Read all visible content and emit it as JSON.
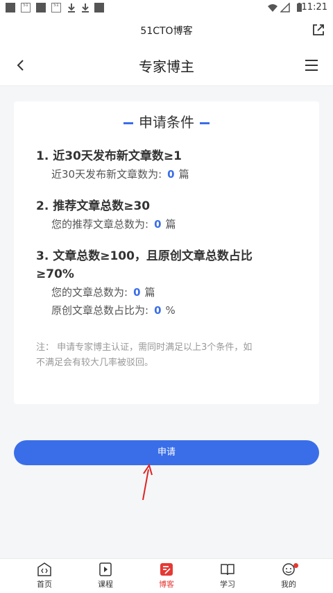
{
  "status_bar": {
    "time": "11:21",
    "app_icon_1": "51",
    "app_icon_2": "51"
  },
  "app_bar": {
    "title": "51CTO博客",
    "share_icon": "share-icon"
  },
  "nav": {
    "title": "专家博主",
    "back_icon": "chevron-left-icon",
    "menu_icon": "menu-icon"
  },
  "card": {
    "header": "申请条件",
    "conditions": [
      {
        "title": "1. 近30天发布新文章数≥1",
        "lines": [
          {
            "label": "近30天发布新文章数为:",
            "value": "0",
            "unit": "篇"
          }
        ]
      },
      {
        "title": "2. 推荐文章总数≥30",
        "lines": [
          {
            "label": "您的推荐文章总数为:",
            "value": "0",
            "unit": "篇"
          }
        ]
      },
      {
        "title_line1": "3. 文章总数≥100，且原创文章总数占比",
        "title_line2": "≥70%",
        "lines": [
          {
            "label": "您的文章总数为:",
            "value": "0",
            "unit": "篇"
          },
          {
            "label": "原创文章总数占比为:",
            "value": "0",
            "unit": "%"
          }
        ]
      }
    ],
    "note_line1": "注： 申请专家博主认证，需同时满足以上3个条件，如",
    "note_line2": "不满足会有较大几率被驳回。"
  },
  "apply_button": "申请",
  "tabs": [
    {
      "label": "首页",
      "icon": "home-icon",
      "active": false
    },
    {
      "label": "课程",
      "icon": "course-icon",
      "active": false
    },
    {
      "label": "博客",
      "icon": "blog-icon",
      "active": true
    },
    {
      "label": "学习",
      "icon": "book-icon",
      "active": false
    },
    {
      "label": "我的",
      "icon": "profile-icon",
      "active": false
    }
  ],
  "colors": {
    "accent": "#3a6ee8",
    "active_tab": "#e53935",
    "annotation_arrow": "#e02020"
  }
}
